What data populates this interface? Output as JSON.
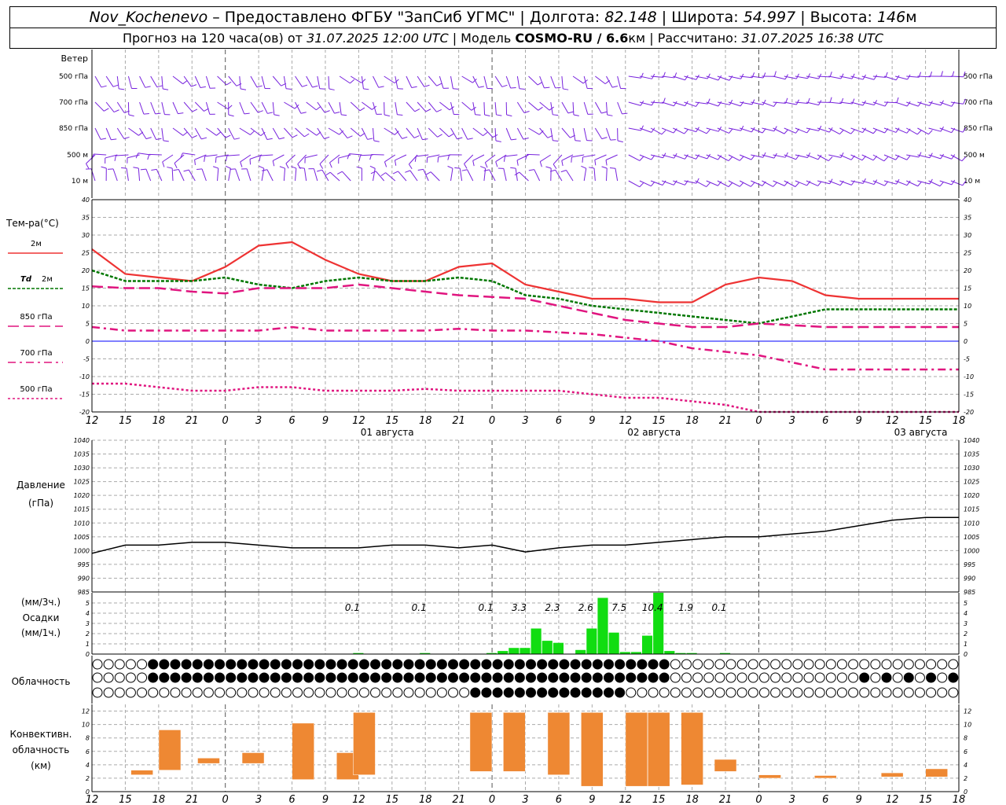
{
  "header": {
    "station": "Nov_Kochenevo",
    "provider": " – Предоставлено ФГБУ \"ЗапСиб УГМС\" | Долгота: ",
    "lon": "82.148",
    "lat_label": " | Широта: ",
    "lat": "54.997",
    "alt_label": " | Высота: ",
    "alt": "146",
    "alt_unit": "м",
    "forecast_prefix": "Прогноз на 120 часа(ов) от ",
    "init": "31.07.2025 12:00 UTC",
    "model_label": " | Модель ",
    "model": "COSMO-RU / 6.6",
    "model_unit": "км",
    "computed_label": " | Рассчитано: ",
    "computed": "31.07.2025 16:38 UTC"
  },
  "x_ticks": [
    "12",
    "15",
    "18",
    "21",
    "0",
    "3",
    "6",
    "9",
    "12",
    "15",
    "18",
    "21",
    "0",
    "3",
    "6",
    "9",
    "12",
    "15",
    "18",
    "21",
    "0",
    "3",
    "6",
    "9",
    "12",
    "15",
    "18"
  ],
  "date_labels": [
    {
      "label": "01 августа",
      "hour": 27
    },
    {
      "label": "02 августа",
      "hour": 51
    },
    {
      "label": "03 августа",
      "hour": 75
    }
  ],
  "colors": {
    "t2m": "#ee3333",
    "td2m": "#007700",
    "t850": "#e0157f",
    "t700": "#e0157f",
    "t500": "#e0157f",
    "wind": "#7722dd",
    "pressure": "#000000",
    "precip": "#11dd11",
    "conv": "#ee8833",
    "zero": "#0000ff"
  },
  "wind": {
    "title": "Ветер",
    "levels": [
      "500 гПа",
      "700 гПа",
      "850 гПа",
      "500 м",
      "10  м"
    ]
  },
  "temperature": {
    "title": "Тем-ра(°С)",
    "legend": [
      {
        "label": "2м"
      },
      {
        "label_italic": "Td",
        "label": "2м"
      },
      {
        "label": "850 гПа"
      },
      {
        "label": "700 гПа"
      },
      {
        "label": "500 гПа"
      }
    ],
    "y_ticks": [
      40,
      35,
      30,
      25,
      20,
      15,
      10,
      5,
      0,
      -5,
      -10,
      -15,
      -20
    ]
  },
  "pressure": {
    "title_line1": "Давление",
    "title_line2": "(гПа)",
    "y_ticks": [
      1040,
      1035,
      1030,
      1025,
      1020,
      1015,
      1010,
      1005,
      1000,
      995,
      990,
      985
    ]
  },
  "precip": {
    "title_line1": "(мм/3ч.)",
    "title_line2": "Осадки",
    "title_line3": "(мм/1ч.)",
    "y_ticks": [
      5,
      4,
      3,
      2,
      1,
      0
    ],
    "totals": [
      {
        "hour": 24,
        "text": "0.1"
      },
      {
        "hour": 30,
        "text": "0.1"
      },
      {
        "hour": 36,
        "text": "0.1"
      },
      {
        "hour": 39,
        "text": "3.3"
      },
      {
        "hour": 42,
        "text": "2.3"
      },
      {
        "hour": 45,
        "text": "2.6"
      },
      {
        "hour": 48,
        "text": "7.5"
      },
      {
        "hour": 51,
        "text": "10.4"
      },
      {
        "hour": 54,
        "text": "1.9"
      },
      {
        "hour": 57,
        "text": "0.1"
      }
    ]
  },
  "clouds": {
    "title": "Облачность"
  },
  "convective": {
    "title_line1": "Конвективн.",
    "title_line2": "облачность",
    "title_line3": "(км)",
    "y_ticks": [
      12,
      10,
      8,
      6,
      4,
      2,
      0
    ]
  },
  "chart_data": [
    {
      "type": "line",
      "title": "Тем-ра(°С)",
      "x_hours_from_init": [
        0,
        3,
        6,
        9,
        12,
        15,
        18,
        21,
        24,
        27,
        30,
        33,
        36,
        39,
        42,
        45,
        48,
        51,
        54,
        57,
        60,
        63,
        66,
        69,
        72,
        75,
        78
      ],
      "series": [
        {
          "name": "2м",
          "values": [
            26,
            19,
            18,
            17,
            21,
            27,
            28,
            23,
            19,
            17,
            17,
            21,
            22,
            16,
            14,
            12,
            12,
            11,
            11,
            16,
            18,
            17,
            13,
            12,
            12,
            12,
            12
          ]
        },
        {
          "name": "Td 2м",
          "values": [
            20,
            17,
            17,
            17,
            18,
            16,
            15,
            17,
            18,
            17,
            17,
            18,
            17,
            13,
            12,
            10,
            9,
            8,
            7,
            6,
            5,
            7,
            9,
            9,
            9,
            9,
            9
          ]
        },
        {
          "name": "850 гПа",
          "values": [
            15.5,
            15,
            15,
            14,
            13.5,
            15,
            15,
            15,
            16,
            15,
            14,
            13,
            12.5,
            12,
            10,
            8,
            6,
            5,
            4,
            4,
            5,
            4.5,
            4,
            4,
            4,
            4,
            4
          ]
        },
        {
          "name": "700 гПа",
          "values": [
            4,
            3,
            3,
            3,
            3,
            3,
            4,
            3,
            3,
            3,
            3,
            3.5,
            3,
            3,
            2.5,
            2,
            1,
            0,
            -2,
            -3,
            -4,
            -6,
            -8,
            -8,
            -8,
            -8,
            -8
          ]
        },
        {
          "name": "500 гПа",
          "values": [
            -12,
            -12,
            -13,
            -14,
            -14,
            -13,
            -13,
            -14,
            -14,
            -14,
            -13.5,
            -14,
            -14,
            -14,
            -14,
            -15,
            -16,
            -16,
            -17,
            -18,
            -20,
            -21,
            -21,
            -21,
            -21,
            -21,
            -21
          ]
        }
      ],
      "ylim": [
        -20,
        40
      ]
    },
    {
      "type": "line",
      "title": "Давление",
      "ylabel": "(гПа)",
      "x_hours_from_init": [
        0,
        3,
        6,
        9,
        12,
        15,
        18,
        21,
        24,
        27,
        30,
        33,
        36,
        39,
        42,
        45,
        48,
        51,
        54,
        57,
        60,
        63,
        66,
        69,
        72,
        75,
        78
      ],
      "series": [
        {
          "name": "",
          "values": [
            999,
            1002,
            1002,
            1003,
            1003,
            1002,
            1001,
            1001,
            1001,
            1002,
            1002,
            1001,
            1002,
            999.5,
            1001,
            1002,
            1002,
            1003,
            1004,
            1005,
            1005,
            1006,
            1007,
            1009,
            1011,
            1012,
            1012
          ]
        }
      ],
      "ylim": [
        985,
        1040
      ]
    },
    {
      "type": "bar",
      "title": "Осадки",
      "x_hours_from_init": [
        24,
        30,
        36,
        37,
        38,
        39,
        40,
        41,
        42,
        44,
        45,
        46,
        47,
        48,
        49,
        50,
        51,
        52,
        53,
        54,
        57
      ],
      "values": [
        0.1,
        0.1,
        0.1,
        0.3,
        0.6,
        0.6,
        2.5,
        1.3,
        1.1,
        0.4,
        2.5,
        5.5,
        2.1,
        0.2,
        0.2,
        1.8,
        6,
        0.3,
        0.1,
        0.1,
        0.1
      ],
      "ylim": [
        0,
        6
      ]
    },
    {
      "type": "bar",
      "title": "Конвективн. облачность (км)",
      "ranges_km": [
        {
          "x": 4.5,
          "base": 2.5,
          "top": 3.2
        },
        {
          "x": 7,
          "base": 3.2,
          "top": 9.2
        },
        {
          "x": 10.5,
          "base": 4.2,
          "top": 5
        },
        {
          "x": 14.5,
          "base": 4.2,
          "top": 5.8
        },
        {
          "x": 19,
          "base": 1.8,
          "top": 10.2
        },
        {
          "x": 23,
          "base": 1.8,
          "top": 5.8
        },
        {
          "x": 24.5,
          "base": 2.5,
          "top": 11.8
        },
        {
          "x": 35,
          "base": 3,
          "top": 11.8
        },
        {
          "x": 38,
          "base": 3,
          "top": 11.8
        },
        {
          "x": 42,
          "base": 2.5,
          "top": 11.8
        },
        {
          "x": 45,
          "base": 0.8,
          "top": 11.8
        },
        {
          "x": 49,
          "base": 0.8,
          "top": 11.8
        },
        {
          "x": 51,
          "base": 0.8,
          "top": 11.8
        },
        {
          "x": 54,
          "base": 1,
          "top": 11.8
        },
        {
          "x": 57,
          "base": 3,
          "top": 4.8
        },
        {
          "x": 61,
          "base": 2,
          "top": 2.5
        },
        {
          "x": 66,
          "base": 2,
          "top": 2.4
        },
        {
          "x": 72,
          "base": 2.2,
          "top": 2.8
        },
        {
          "x": 76,
          "base": 2.2,
          "top": 3.4
        }
      ],
      "ylim": [
        0,
        13
      ]
    }
  ]
}
